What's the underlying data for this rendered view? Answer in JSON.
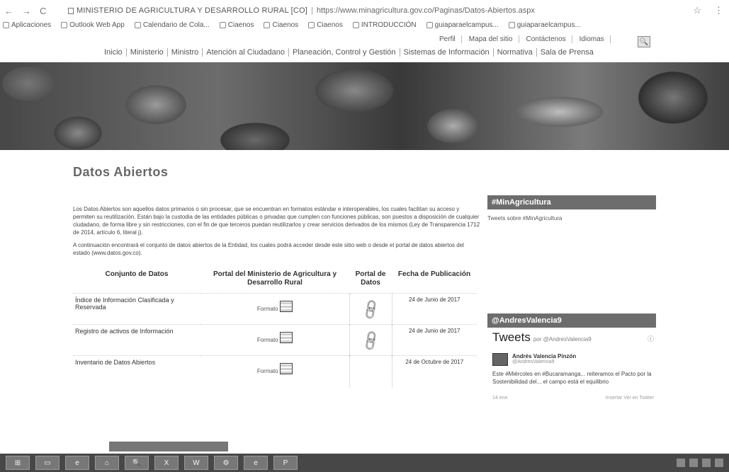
{
  "browser": {
    "nav_glyphs": [
      "←",
      "→",
      "C"
    ],
    "site_name": "MINISTERIO DE AGRICULTURA Y DESARROLLO RURAL [CO]",
    "url": "https://www.minagricultura.gov.co/Paginas/Datos-Abiertos.aspx",
    "right_glyphs": [
      "☆",
      "⋮"
    ],
    "bookmarks": [
      "Aplicaciones",
      "Outlook Web App",
      "Calendario de Cola...",
      "Ciaenos",
      "Ciaenos",
      "Ciaenos",
      "INTRODUCCIÓN",
      "guiaparaelcampus...",
      "guiaparaelcampus..."
    ]
  },
  "header": {
    "top_links": [
      "Perfil",
      "Mapa del sitio",
      "Contáctenos",
      "Idiomas"
    ],
    "search_glyph": "🔍",
    "nav": [
      "Inicio",
      "Ministerio",
      "Ministro",
      "Atención al Ciudadano",
      "Planeación, Control y Gestión",
      "Sistemas de Información",
      "Normativa",
      "Sala de Prensa"
    ]
  },
  "main": {
    "title": "Datos Abiertos",
    "intro_1": "Los Datos Abiertos son aquellos datos primarios o sin procesar, que se encuentran en formatos estándar e interoperables, los cuales facilitan su acceso y permiten su reutilización. Están bajo la custodia de las entidades públicas o privadas que cumplen con funciones públicas, son puestos a disposición de cualquier ciudadano, de forma libre y sin restricciones, con el fin de que terceros puedan reutilizarlos y crear servicios derivados de los mismos (Ley de Transparencia 1712 de 2014, artículo 6, literal j).",
    "intro_2": "A continuación encontrará el conjunto de datos abiertos de la Entidad, los cuales podrá acceder desde este sitio web o desde el portal de datos abiertos del estado (www.datos.gov.co).",
    "table": {
      "headers": [
        "Conjunto de Datos",
        "Portal del Ministerio de Agricultura y Desarrollo Rural",
        "Portal de Datos",
        "Fecha de Publicación"
      ],
      "format_label": "Formato",
      "link_glyph": "🔗",
      "rows": [
        {
          "name": "Índice de Información Clasificada y Reservada",
          "date": "24 de Junio de 2017"
        },
        {
          "name": "Registro de activos de Información",
          "date": "24 de Junio de 2017"
        },
        {
          "name": "Inventario de Datos Abiertos",
          "date": "24 de Octubre de 2017"
        }
      ]
    }
  },
  "sidebar": {
    "hashtag": "#MinAgricultura",
    "hashtag_sub": "Tweets sobre #MinAgricultura",
    "handle_box": "@AndresValencia9",
    "tweets_title": "Tweets",
    "tweets_by": "por @AndresValencia9",
    "info_glyph": "ⓘ",
    "tweet": {
      "author": "Andrés Valencia Pinzón",
      "handle": "@AndresValencia9",
      "text": "Este #Miércoles en #Bucaramanga... reiteramos el Pacto por la Sostenibilidad del... el campo está el equilibrio",
      "time": "14 ene.",
      "footer_right": "Insertar Ver en Twitter"
    }
  },
  "taskbar": {
    "buttons": [
      "⊞",
      "▭",
      "e",
      "⌂",
      "🔍",
      "X",
      "W",
      "⚙",
      "e",
      "P"
    ]
  }
}
